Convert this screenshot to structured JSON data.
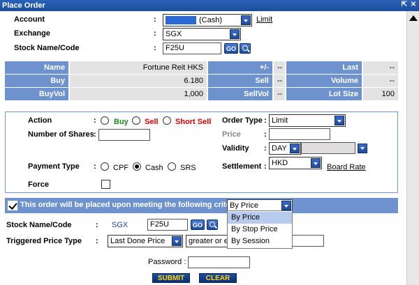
{
  "window": {
    "title": "Place Order"
  },
  "form": {
    "account_label": "Account",
    "account_value": "(Cash)",
    "account_link": "Limit",
    "exchange_label": "Exchange",
    "exchange_value": "SGX",
    "stock_label": "Stock Name/Code",
    "stock_value": "F25U",
    "go_label": "GO"
  },
  "quote": {
    "rows": [
      [
        {
          "h": "Name"
        },
        {
          "v": "Fortune Reit HKS"
        },
        {
          "h": "+/-"
        },
        {
          "v": "--"
        },
        {
          "h": "Last"
        },
        {
          "v": "--"
        }
      ],
      [
        {
          "h": "Buy"
        },
        {
          "v": "6.180"
        },
        {
          "h": "Sell"
        },
        {
          "v": "--"
        },
        {
          "h": "Volume"
        },
        {
          "v": "--"
        }
      ],
      [
        {
          "h": "BuyVol"
        },
        {
          "v": "1,000"
        },
        {
          "h": "SellVol"
        },
        {
          "v": "--"
        },
        {
          "h": "Lot Size"
        },
        {
          "v": "100"
        }
      ]
    ]
  },
  "order": {
    "action_label": "Action",
    "buy_label": "Buy",
    "sell_label": "Sell",
    "short_sell_label": "Short Sell",
    "shares_label": "Number of Shares",
    "order_type_label": "Order Type",
    "order_type_value": "Limit",
    "price_label": "Price",
    "validity_label": "Validity",
    "validity_value": "DAY",
    "payment_label": "Payment Type",
    "cpf_label": "CPF",
    "cash_label": "Cash",
    "srs_label": "SRS",
    "settlement_label": "Settlement",
    "settlement_value": "HKD",
    "board_rate_link": "Board Rate",
    "force_label": "Force"
  },
  "condition": {
    "bar_text": "This order will be placed upon meeting the following criteria:",
    "criteria_value": "By Price",
    "menu": [
      "By Price",
      "By Stop Price",
      "By Session"
    ],
    "stock_label": "Stock Name/Code",
    "exchange": "SGX",
    "stock_value": "F25U",
    "triggered_label": "Triggered Price Type",
    "triggered_value": "Last Done Price",
    "compare_value": "greater or e"
  },
  "footer": {
    "password_label": "Password :",
    "submit_label": "SUBMIT",
    "clear_label": "CLEAR"
  },
  "colors": {
    "header_blue": "#1b4d9c",
    "panel_blue": "#6d92ce",
    "buy_green": "#1a8a1a",
    "sell_red": "#e00000",
    "button_text_yellow": "#ffd800"
  }
}
